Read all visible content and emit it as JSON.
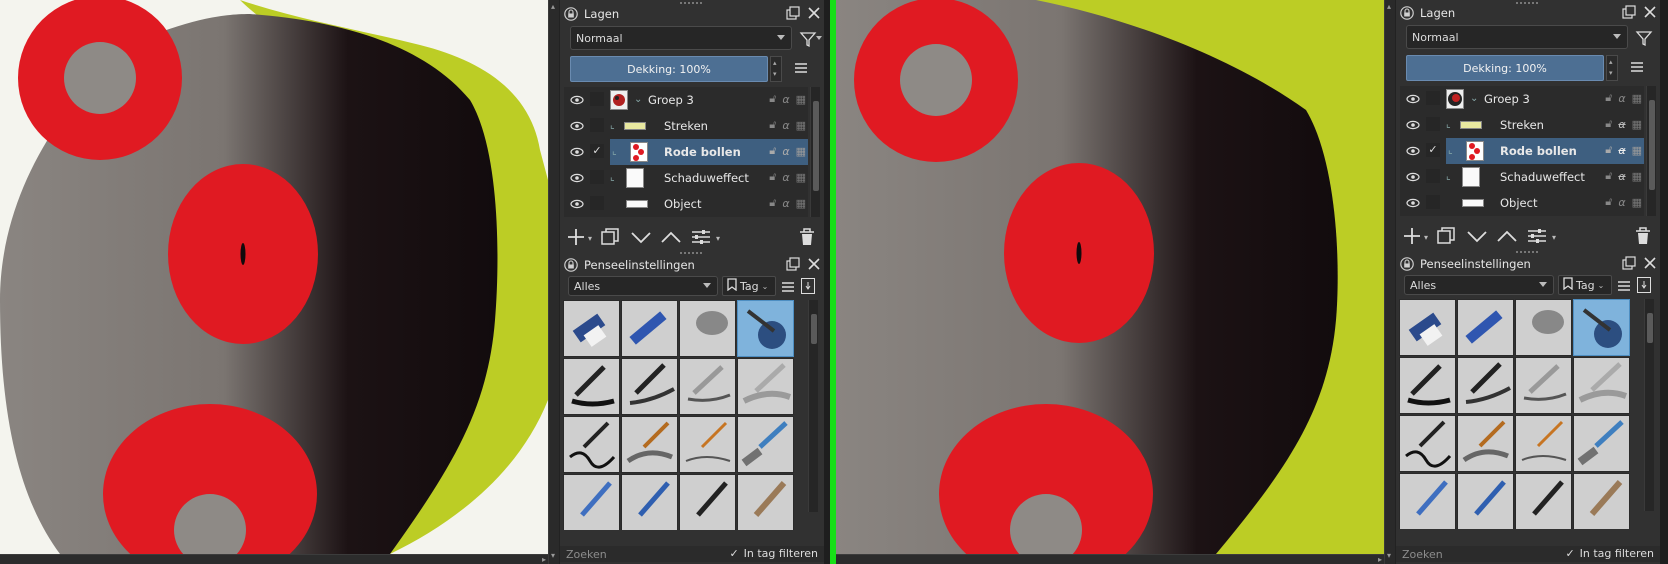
{
  "panels": [
    {
      "layers_panel": {
        "title": "Lagen",
        "blend_mode": "Normaal",
        "opacity_label": "Dekking:",
        "opacity_value": "100%",
        "layers": [
          {
            "name": "Groep 3",
            "selected": false,
            "checked": false
          },
          {
            "name": "Streken",
            "selected": false,
            "checked": false
          },
          {
            "name": "Rode bollen",
            "selected": true,
            "checked": true
          },
          {
            "name": "Schaduweffect",
            "selected": false,
            "checked": false
          },
          {
            "name": "Object",
            "selected": false,
            "checked": false
          }
        ]
      },
      "brush_panel": {
        "title": "Penseelinstellingen",
        "filter": "Alles",
        "tag_label": "Tag",
        "search_placeholder": "Zoeken",
        "filter_in_tag": "In tag filteren"
      }
    },
    {
      "layers_panel": {
        "title": "Lagen",
        "blend_mode": "Normaal",
        "opacity_label": "Dekking:",
        "opacity_value": "100%",
        "layers": [
          {
            "name": "Groep 3",
            "selected": false,
            "checked": false
          },
          {
            "name": "Streken",
            "selected": false,
            "checked": false
          },
          {
            "name": "Rode bollen",
            "selected": true,
            "checked": true
          },
          {
            "name": "Schaduweffect",
            "selected": false,
            "checked": false
          },
          {
            "name": "Object",
            "selected": false,
            "checked": false
          }
        ]
      },
      "brush_panel": {
        "title": "Penseelinstellingen",
        "filter": "Alles",
        "tag_label": "Tag",
        "search_placeholder": "Zoeken",
        "filter_in_tag": "In tag filteren"
      }
    }
  ],
  "colors": {
    "accent_selection": "#3e5f80",
    "opacity_bar": "#4d6f93",
    "divider_green": "#17e017",
    "red_shape": "#e01a22",
    "lime_stroke": "#bccd25"
  },
  "icons": [
    "lock-icon",
    "float-icon",
    "close-icon",
    "eye-icon",
    "lock-small-icon",
    "alpha-icon",
    "inherit-alpha-icon",
    "add-icon",
    "duplicate-icon",
    "move-down-icon",
    "move-up-icon",
    "properties-icon",
    "delete-icon",
    "filter-icon",
    "menu-icon",
    "tag-icon",
    "view-icon"
  ]
}
